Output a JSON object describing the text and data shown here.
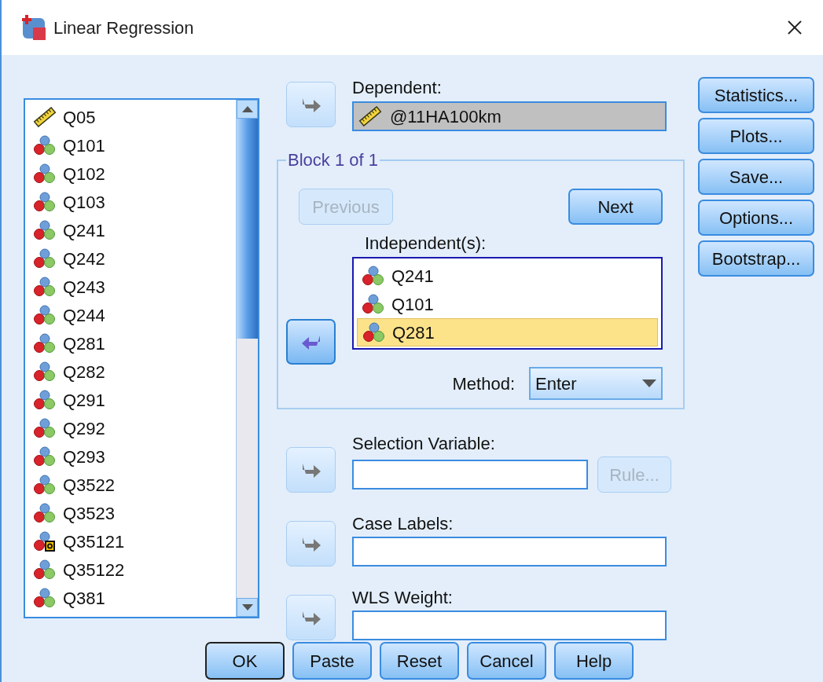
{
  "window": {
    "title": "Linear Regression"
  },
  "variables": [
    {
      "name": "Q05",
      "kind": "scale"
    },
    {
      "name": "Q101",
      "kind": "nominal"
    },
    {
      "name": "Q102",
      "kind": "nominal"
    },
    {
      "name": "Q103",
      "kind": "nominal"
    },
    {
      "name": "Q241",
      "kind": "nominal"
    },
    {
      "name": "Q242",
      "kind": "nominal"
    },
    {
      "name": "Q243",
      "kind": "nominal"
    },
    {
      "name": "Q244",
      "kind": "nominal"
    },
    {
      "name": "Q281",
      "kind": "nominal"
    },
    {
      "name": "Q282",
      "kind": "nominal"
    },
    {
      "name": "Q291",
      "kind": "nominal"
    },
    {
      "name": "Q292",
      "kind": "nominal"
    },
    {
      "name": "Q293",
      "kind": "nominal"
    },
    {
      "name": "Q3522",
      "kind": "nominal"
    },
    {
      "name": "Q3523",
      "kind": "nominal"
    },
    {
      "name": "Q35121",
      "kind": "string"
    },
    {
      "name": "Q35122",
      "kind": "nominal"
    },
    {
      "name": "Q381",
      "kind": "nominal"
    }
  ],
  "dependent": {
    "label": "Dependent:",
    "value": "@11HA100km",
    "kind": "scale",
    "arrow_active": false
  },
  "block": {
    "title": "Block 1 of 1",
    "previous": {
      "label": "Previous",
      "disabled": true
    },
    "next": {
      "label": "Next",
      "disabled": false
    },
    "independents_label": "Independent(s):",
    "arrow_active": true,
    "independents": [
      {
        "name": "Q241",
        "kind": "nominal",
        "selected": false
      },
      {
        "name": "Q101",
        "kind": "nominal",
        "selected": false
      },
      {
        "name": "Q281",
        "kind": "nominal",
        "selected": true
      }
    ],
    "method": {
      "label": "Method:",
      "value": "Enter"
    }
  },
  "selection": {
    "label": "Selection Variable:",
    "arrow_active": false,
    "rule": {
      "label": "Rule...",
      "disabled": true
    }
  },
  "case_labels": {
    "label": "Case Labels:",
    "arrow_active": false
  },
  "wls_weight": {
    "label": "WLS Weight:",
    "arrow_active": false
  },
  "side_buttons": [
    "Statistics...",
    "Plots...",
    "Save...",
    "Options...",
    "Bootstrap..."
  ],
  "bottom_buttons": [
    {
      "label": "OK",
      "default": true
    },
    {
      "label": "Paste",
      "default": false
    },
    {
      "label": "Reset",
      "default": false
    },
    {
      "label": "Cancel",
      "default": false
    },
    {
      "label": "Help",
      "default": false
    }
  ]
}
